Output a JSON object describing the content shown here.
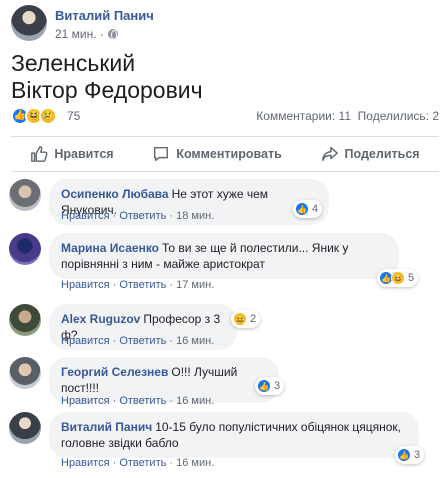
{
  "post": {
    "author": "Виталий Панич",
    "time": "21 мин. ·",
    "text": "Зеленський\nВіктор Федорович",
    "reactions_count": "75",
    "stats": "Комментарии: 11  Поделились: 2",
    "reaction_icons": [
      "like-icon",
      "haha-icon",
      "sad-icon"
    ]
  },
  "actions": {
    "like": "Нравится",
    "comment": "Комментировать",
    "share": "Поделиться"
  },
  "comments": [
    {
      "name": "Осипенко Любава",
      "text": "Не этот хуже чем Янукович.",
      "like": "Нравится",
      "reply": "Ответить",
      "time": "18 мин.",
      "reactions": "4"
    },
    {
      "name": "Марина Исаенко",
      "text": "То ви зе ще й полестили... Яник у порівнянні з ним - майже аристократ",
      "like": "Нравится",
      "reply": "Ответить",
      "time": "17 мин.",
      "reactions": "5"
    },
    {
      "name": "Alex Ruguzov",
      "text": "Професор з 3 ф?",
      "like": "Нравится",
      "reply": "Ответить",
      "time": "16 мин.",
      "reactions": "2"
    },
    {
      "name": "Георгий Селезнев",
      "text": "О!!! Лучший пост!!!!",
      "like": "Нравится",
      "reply": "Ответить",
      "time": "16 мин.",
      "reactions": "3"
    },
    {
      "name": "Виталий Панич",
      "text": "10-15 було популістичних обіцянок цяцянок, головне звідки бабло",
      "like": "Нравится",
      "reply": "Ответить",
      "time": "16 мин.",
      "reactions": "3"
    }
  ],
  "colors": {
    "link": "#385898",
    "like_blue": "#1877f2",
    "emoji_yellow": "#f7b928",
    "bubble": "#f2f3f5"
  }
}
